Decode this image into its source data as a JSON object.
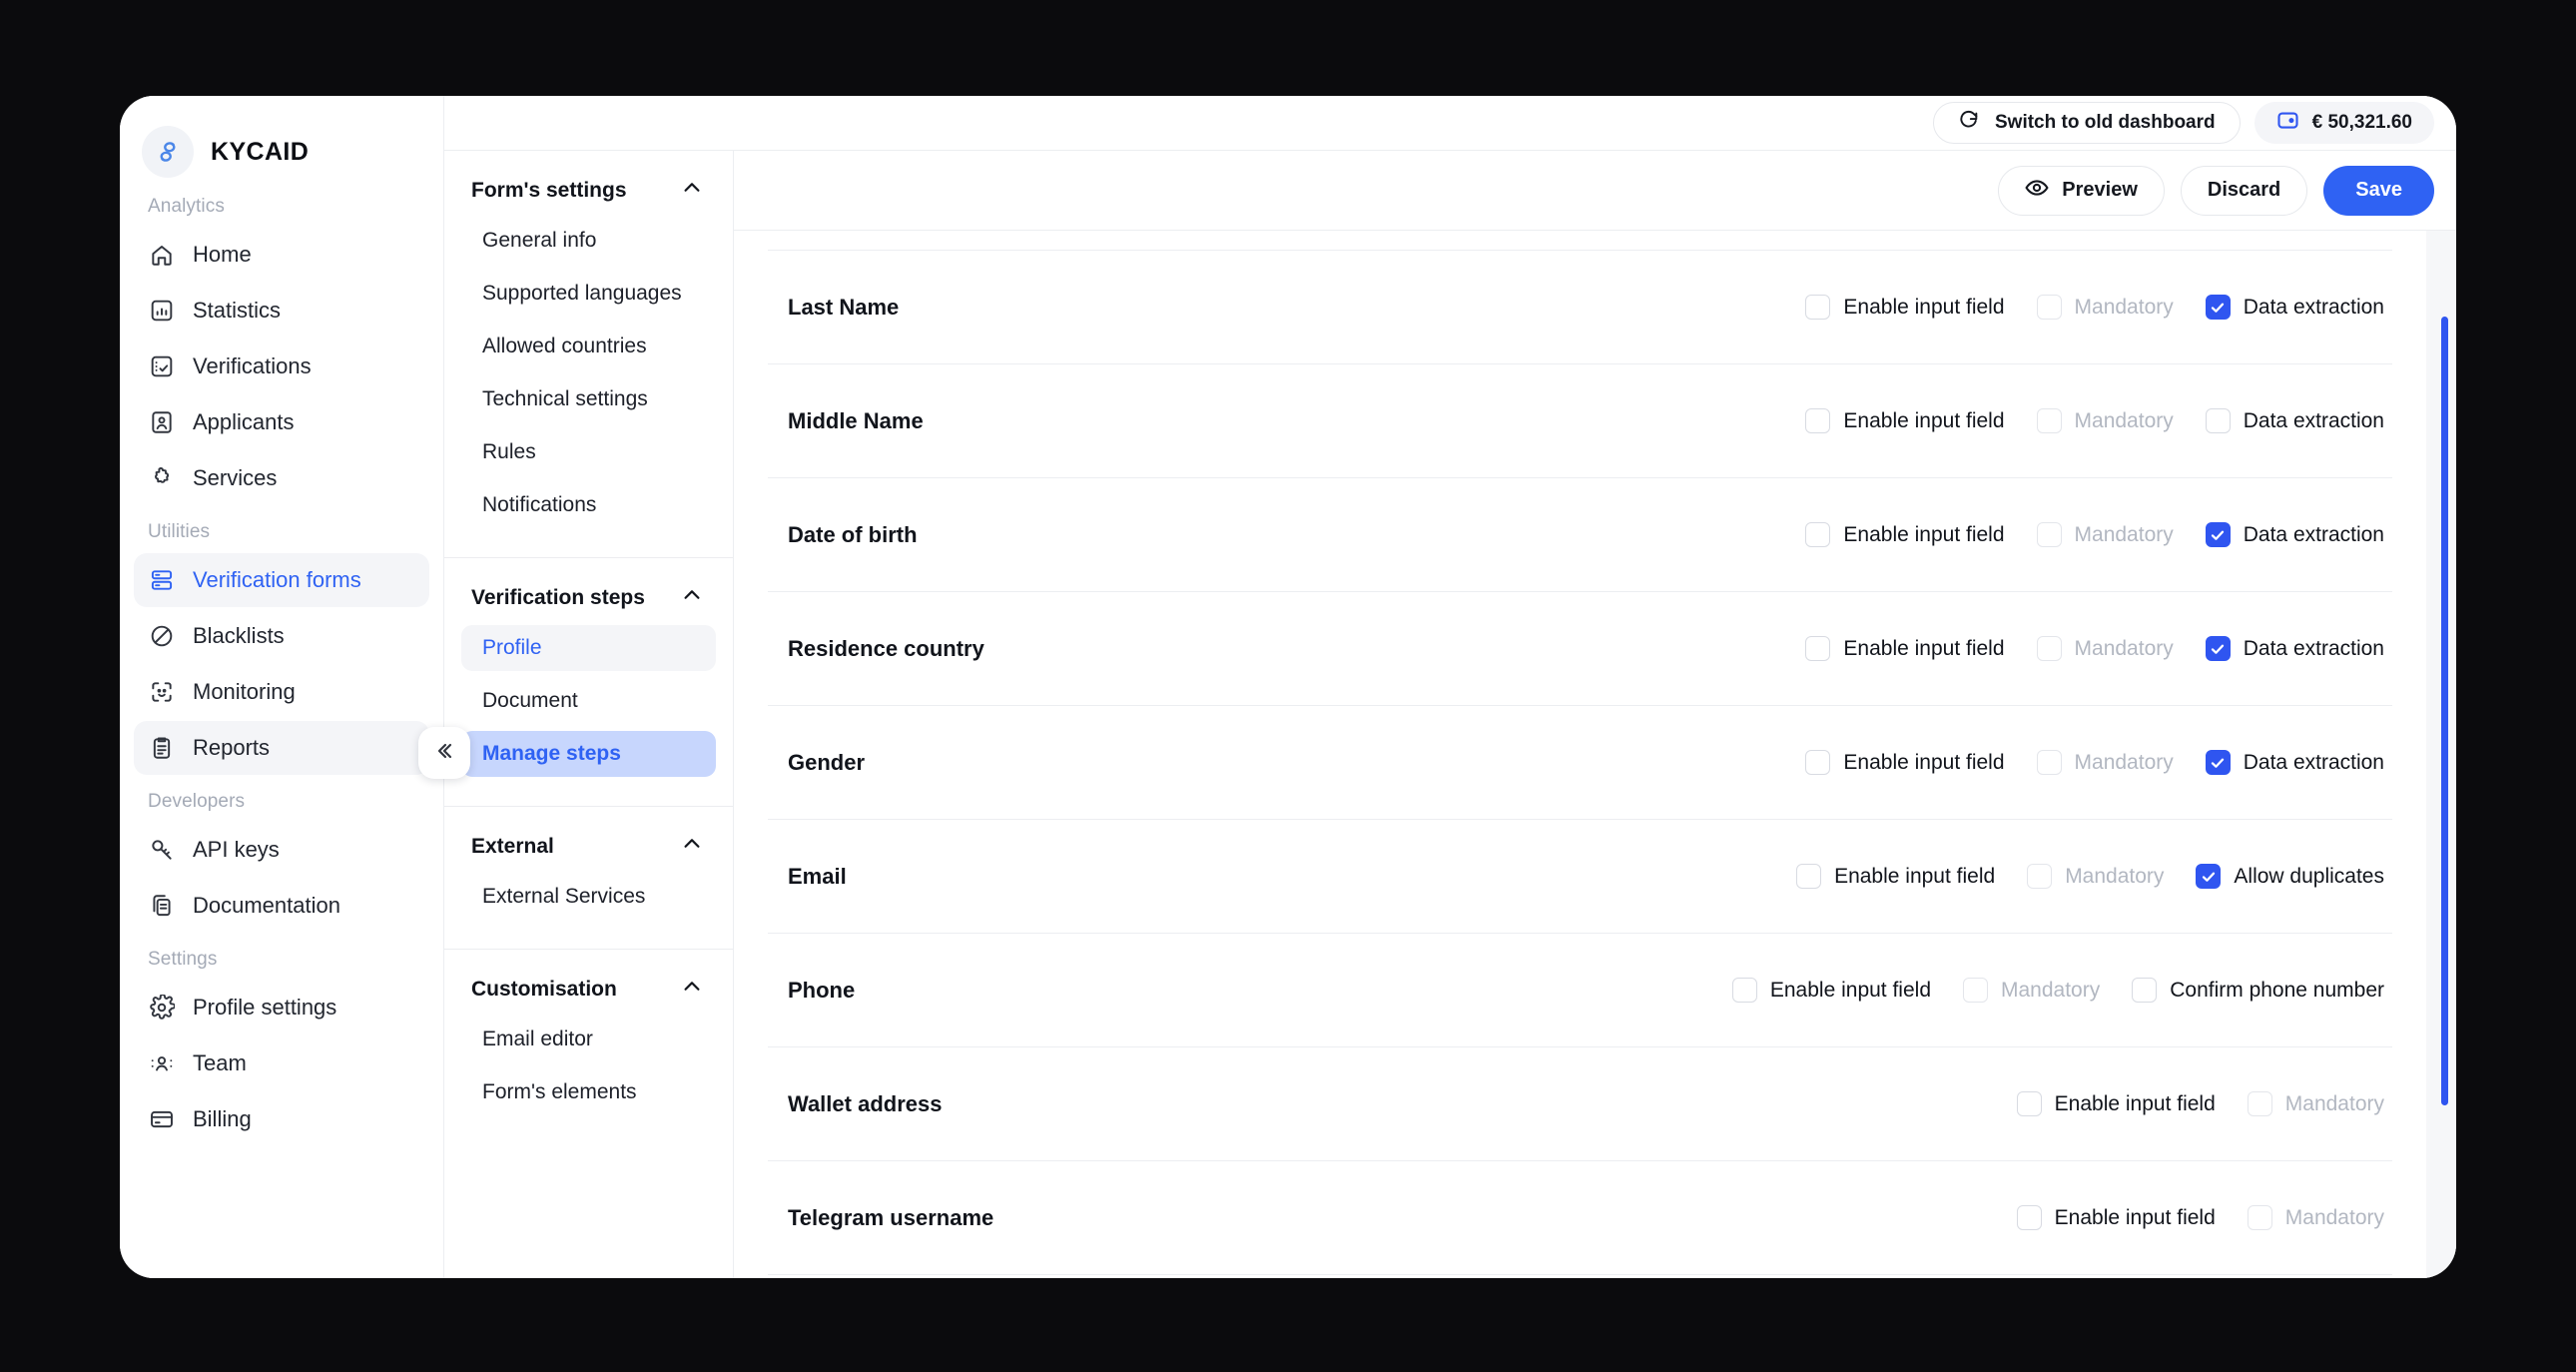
{
  "brand": {
    "name": "KYCAID",
    "logo_icon": "kycaid-swirl-icon"
  },
  "sidebar": {
    "groups": [
      {
        "label": "Analytics",
        "items": [
          {
            "label": "Home",
            "icon": "home-icon",
            "state": "default"
          },
          {
            "label": "Statistics",
            "icon": "chart-box-icon",
            "state": "default"
          },
          {
            "label": "Verifications",
            "icon": "checklist-icon",
            "state": "default"
          },
          {
            "label": "Applicants",
            "icon": "id-card-icon",
            "state": "default"
          },
          {
            "label": "Services",
            "icon": "puzzle-icon",
            "state": "default"
          }
        ]
      },
      {
        "label": "Utilities",
        "items": [
          {
            "label": "Verification forms",
            "icon": "forms-icon",
            "state": "active"
          },
          {
            "label": "Blacklists",
            "icon": "ban-icon",
            "state": "default"
          },
          {
            "label": "Monitoring",
            "icon": "face-scan-icon",
            "state": "default"
          },
          {
            "label": "Reports",
            "icon": "clipboard-icon",
            "state": "hover"
          }
        ]
      },
      {
        "label": "Developers",
        "items": [
          {
            "label": "API keys",
            "icon": "key-icon",
            "state": "default"
          },
          {
            "label": "Documentation",
            "icon": "docs-icon",
            "state": "default"
          }
        ]
      },
      {
        "label": "Settings",
        "items": [
          {
            "label": "Profile settings",
            "icon": "gear-icon",
            "state": "default"
          },
          {
            "label": "Team",
            "icon": "people-icon",
            "state": "default"
          },
          {
            "label": "Billing",
            "icon": "credit-card-icon",
            "state": "default"
          }
        ]
      }
    ],
    "collapse_icon": "double-chevron-left-icon"
  },
  "subnav": {
    "sections": [
      {
        "title": "Form's settings",
        "chevron": "chevron-up-icon",
        "items": [
          {
            "label": "General info",
            "state": "default"
          },
          {
            "label": "Supported languages",
            "state": "default"
          },
          {
            "label": "Allowed countries",
            "state": "default"
          },
          {
            "label": "Technical settings",
            "state": "default"
          },
          {
            "label": "Rules",
            "state": "default"
          },
          {
            "label": "Notifications",
            "state": "default"
          }
        ]
      },
      {
        "title": "Verification steps",
        "chevron": "chevron-up-icon",
        "items": [
          {
            "label": "Profile",
            "state": "selected-light"
          },
          {
            "label": "Document",
            "state": "default"
          },
          {
            "label": "Manage steps",
            "state": "selected-blue"
          }
        ]
      },
      {
        "title": "External",
        "chevron": "chevron-up-icon",
        "items": [
          {
            "label": "External Services",
            "state": "default"
          }
        ]
      },
      {
        "title": "Customisation",
        "chevron": "chevron-up-icon",
        "items": [
          {
            "label": "Email editor",
            "state": "default"
          },
          {
            "label": "Form's elements",
            "state": "default"
          }
        ]
      }
    ]
  },
  "topbar": {
    "switch_label": "Switch to old dashboard",
    "switch_icon": "refresh-icon",
    "balance": "€ 50,321.60",
    "balance_icon": "wallet-icon"
  },
  "actionbar": {
    "preview_label": "Preview",
    "preview_icon": "eye-icon",
    "discard_label": "Discard",
    "save_label": "Save",
    "accent_color": "#2f62f3"
  },
  "form_rows": [
    {
      "label": "Last Name",
      "options": [
        {
          "label": "Enable input field",
          "checked": false,
          "dim": false
        },
        {
          "label": "Mandatory",
          "checked": false,
          "dim": true
        },
        {
          "label": "Data extraction",
          "checked": true,
          "dim": false
        }
      ]
    },
    {
      "label": "Middle Name",
      "options": [
        {
          "label": "Enable input field",
          "checked": false,
          "dim": false
        },
        {
          "label": "Mandatory",
          "checked": false,
          "dim": true
        },
        {
          "label": "Data extraction",
          "checked": false,
          "dim": false
        }
      ]
    },
    {
      "label": "Date of birth",
      "options": [
        {
          "label": "Enable input field",
          "checked": false,
          "dim": false
        },
        {
          "label": "Mandatory",
          "checked": false,
          "dim": true
        },
        {
          "label": "Data extraction",
          "checked": true,
          "dim": false
        }
      ]
    },
    {
      "label": "Residence country",
      "options": [
        {
          "label": "Enable input field",
          "checked": false,
          "dim": false
        },
        {
          "label": "Mandatory",
          "checked": false,
          "dim": true
        },
        {
          "label": "Data extraction",
          "checked": true,
          "dim": false
        }
      ]
    },
    {
      "label": "Gender",
      "options": [
        {
          "label": "Enable input field",
          "checked": false,
          "dim": false
        },
        {
          "label": "Mandatory",
          "checked": false,
          "dim": true
        },
        {
          "label": "Data extraction",
          "checked": true,
          "dim": false
        }
      ]
    },
    {
      "label": "Email",
      "options": [
        {
          "label": "Enable input field",
          "checked": false,
          "dim": false
        },
        {
          "label": "Mandatory",
          "checked": false,
          "dim": true
        },
        {
          "label": "Allow duplicates",
          "checked": true,
          "dim": false
        }
      ]
    },
    {
      "label": "Phone",
      "options": [
        {
          "label": "Enable input field",
          "checked": false,
          "dim": false
        },
        {
          "label": "Mandatory",
          "checked": false,
          "dim": true
        },
        {
          "label": "Confirm phone number",
          "checked": false,
          "dim": false
        }
      ]
    },
    {
      "label": "Wallet address",
      "options": [
        {
          "label": "Enable input field",
          "checked": false,
          "dim": false
        },
        {
          "label": "Mandatory",
          "checked": false,
          "dim": true
        }
      ]
    },
    {
      "label": "Telegram username",
      "options": [
        {
          "label": "Enable input field",
          "checked": false,
          "dim": false
        },
        {
          "label": "Mandatory",
          "checked": false,
          "dim": true
        }
      ]
    }
  ],
  "scrollbar": {
    "thumb_color": "#2f55f0"
  }
}
